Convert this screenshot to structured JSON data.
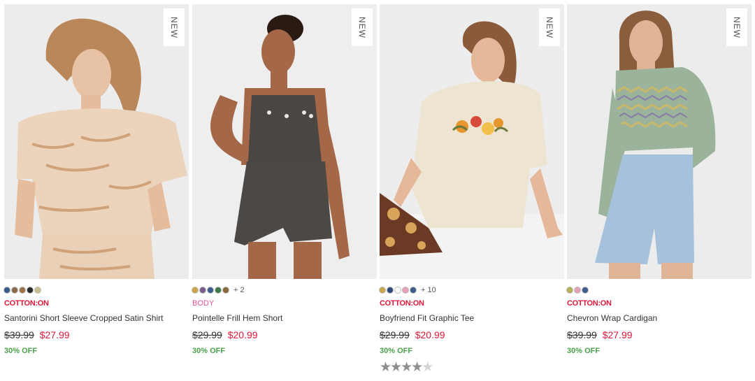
{
  "products": [
    {
      "badge": "NEW",
      "brand": "COTTON:ON",
      "name": "Santorini Short Sleeve Cropped Satin Shirt",
      "old_price": "$39.99",
      "new_price": "$27.99",
      "discount": "30% OFF",
      "swatches": [
        "#3b5a8c",
        "#8a6a4a",
        "#a07048",
        "#2a2a2a",
        "#c9bf8f"
      ],
      "more_colors": ""
    },
    {
      "badge": "NEW",
      "brand": "BODY",
      "name": "Pointelle Frill Hem Short",
      "old_price": "$29.99",
      "new_price": "$20.99",
      "discount": "30% OFF",
      "swatches": [
        "#c9a64a",
        "#7a5a8a",
        "#3d5d8d",
        "#3d7a4a",
        "#8a6a3a"
      ],
      "more_colors": "+ 2"
    },
    {
      "badge": "NEW",
      "brand": "COTTON:ON",
      "name": "Boyfriend Fit Graphic Tee",
      "old_price": "$29.99",
      "new_price": "$20.99",
      "discount": "30% OFF",
      "swatches": [
        "#c9a64a",
        "#2e4a7a",
        "#ffffff",
        "#e6a0b8",
        "#3d5d8d"
      ],
      "more_colors": "+ 10",
      "rating": 4.5
    },
    {
      "badge": "NEW",
      "brand": "COTTON:ON",
      "name": "Chevron Wrap Cardigan",
      "old_price": "$39.99",
      "new_price": "$27.99",
      "discount": "30% OFF",
      "swatches": [
        "#b5b05a",
        "#e6a0b8",
        "#3d5d8d"
      ],
      "more_colors": ""
    }
  ],
  "colors": {
    "sale": "#e0183a",
    "discount": "#4aa14a",
    "brand_body": "#e9559b"
  }
}
